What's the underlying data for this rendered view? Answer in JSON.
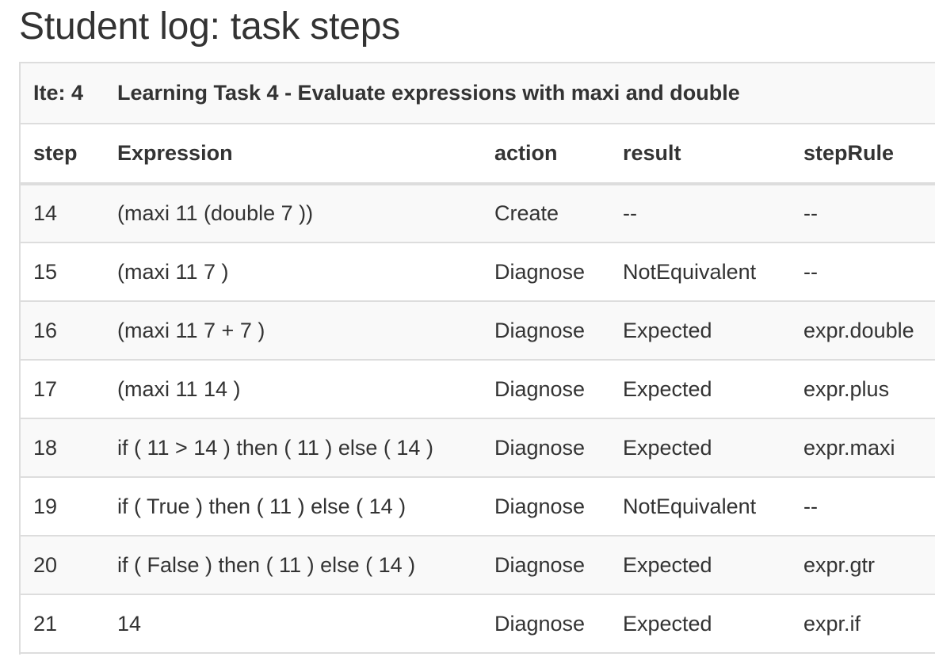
{
  "page": {
    "title": "Student log: task steps"
  },
  "task": {
    "ite_label": "Ite: 4",
    "name": "Learning Task 4 - Evaluate expressions with maxi and double"
  },
  "columns": [
    "step",
    "Expression",
    "action",
    "result",
    "stepRule"
  ],
  "rows": [
    {
      "step": "14",
      "expression": "(maxi 11 (double 7 ))",
      "action": "Create",
      "result": "--",
      "stepRule": "--"
    },
    {
      "step": "15",
      "expression": "(maxi 11 7 )",
      "action": "Diagnose",
      "result": "NotEquivalent",
      "stepRule": "--"
    },
    {
      "step": "16",
      "expression": "(maxi 11 7 + 7 )",
      "action": "Diagnose",
      "result": "Expected",
      "stepRule": "expr.double"
    },
    {
      "step": "17",
      "expression": "(maxi 11 14 )",
      "action": "Diagnose",
      "result": "Expected",
      "stepRule": "expr.plus"
    },
    {
      "step": "18",
      "expression": "if ( 11 > 14 ) then ( 11 ) else ( 14 )",
      "action": "Diagnose",
      "result": "Expected",
      "stepRule": "expr.maxi"
    },
    {
      "step": "19",
      "expression": "if ( True ) then ( 11 ) else ( 14 )",
      "action": "Diagnose",
      "result": "NotEquivalent",
      "stepRule": "--"
    },
    {
      "step": "20",
      "expression": "if ( False ) then ( 11 ) else ( 14 )",
      "action": "Diagnose",
      "result": "Expected",
      "stepRule": "expr.gtr"
    },
    {
      "step": "21",
      "expression": "14",
      "action": "Diagnose",
      "result": "Expected",
      "stepRule": "expr.if"
    }
  ]
}
